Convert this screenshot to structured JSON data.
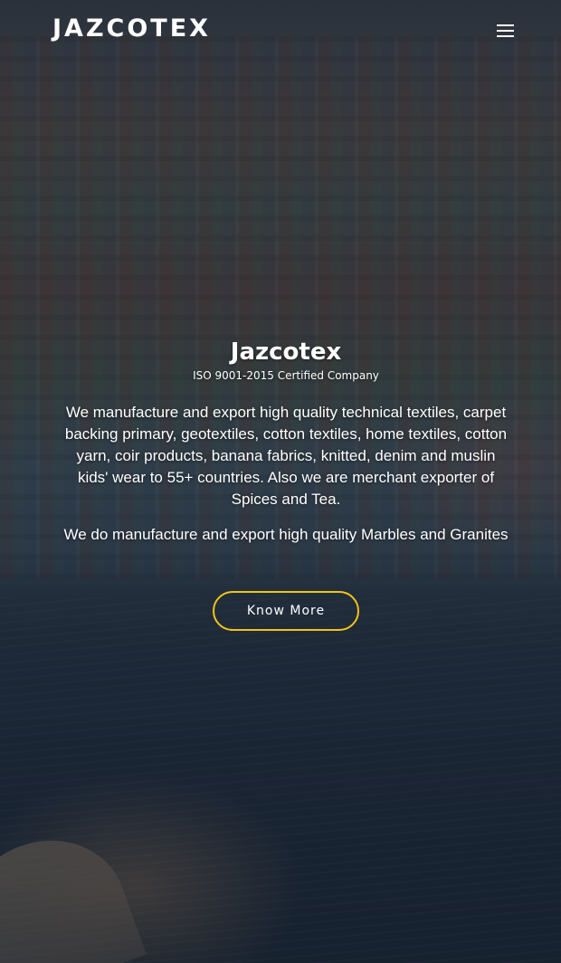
{
  "header": {
    "brand": "JAZCOTEX",
    "menu_icon": "hamburger-menu-icon"
  },
  "hero": {
    "title": "Jazcotex",
    "subtitle": "ISO 9001-2015 Certified Company",
    "description": "We manufacture and export high quality technical textiles, carpet backing primary, geotextiles, cotton textiles, home textiles, cotton yarn, coir products, banana fabrics, knitted, denim and muslin kids' wear to 55+ countries. Also we are merchant exporter of Spices and Tea.",
    "description2": "We do manufacture and export high quality Marbles and Granites",
    "cta_label": "Know More"
  },
  "colors": {
    "accent_border": "#f0c419",
    "text": "#ffffff"
  }
}
